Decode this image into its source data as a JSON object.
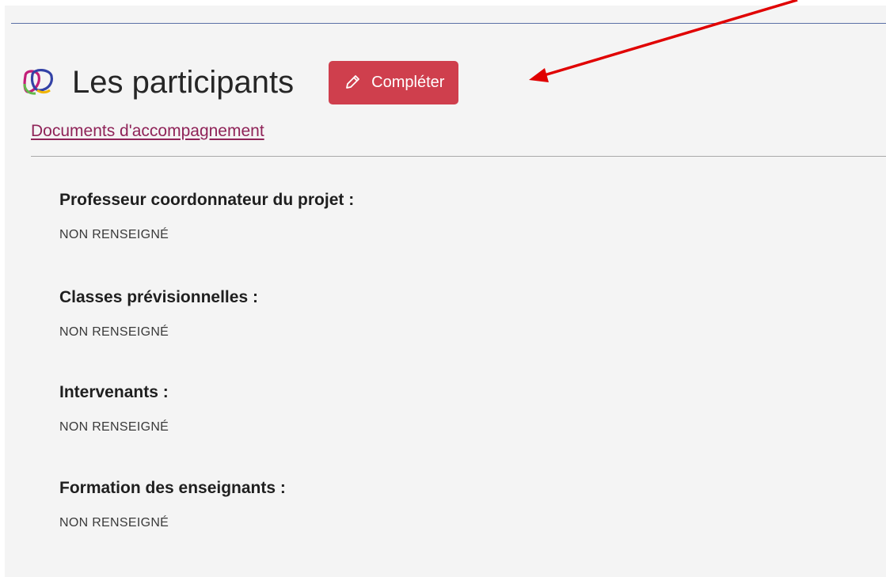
{
  "header": {
    "title": "Les participants",
    "logo_icon": "overlapping-speech-bubbles-icon",
    "complete_button": {
      "label": "Compléter",
      "icon": "pencil-icon",
      "color": "#cf3f4d"
    }
  },
  "documents_link": "Documents d'accompagnement",
  "sections": [
    {
      "title": "Professeur coordonnateur du projet :",
      "value": "NON RENSEIGNÉ"
    },
    {
      "title": "Classes prévisionnelles :",
      "value": "NON RENSEIGNÉ"
    },
    {
      "title": "Intervenants :",
      "value": "NON RENSEIGNÉ"
    },
    {
      "title": "Formation des enseignants :",
      "value": "NON RENSEIGNÉ"
    }
  ],
  "annotation": {
    "type": "arrow",
    "color": "#e00000",
    "points_to": "complete-button"
  },
  "colors": {
    "link": "#8f2358",
    "top_rule": "#5b6fa6",
    "background": "#f4f4f4"
  }
}
